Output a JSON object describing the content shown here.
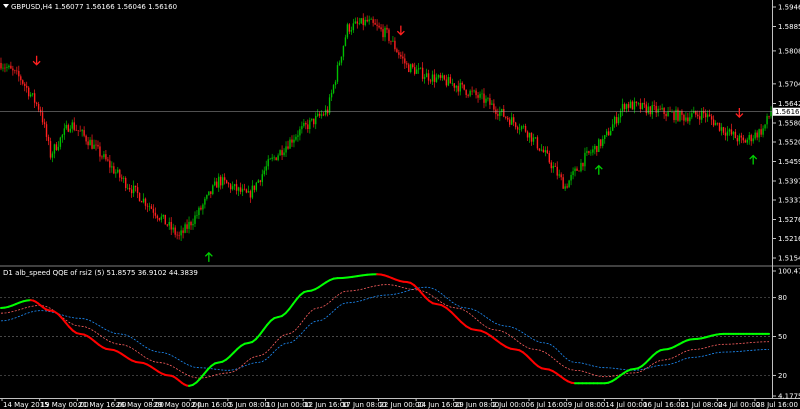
{
  "window": {
    "main_title": "GBPUSD,H4  1.56077 1.56166 1.56046 1.56160",
    "indicator_title": "D1 alb_speed QQE of rsi2 (5) 51.8575 36.9102 44.3839",
    "title_icon": "triangle-down-icon"
  },
  "colors": {
    "background": "#000000",
    "bull_candle": "#00c000",
    "bear_candle": "#ff2020",
    "axis": "#c0c0c0",
    "grid": "#404040",
    "current_price_line": "#a0a0a0",
    "current_price_label_bg": "#ffffff",
    "up_arrow": "#00d000",
    "down_arrow": "#ff2020",
    "qqe_up": "#00ff00",
    "qqe_down": "#ff0000",
    "qqe_fast": "#ff6060",
    "qqe_slow": "#1e90ff"
  },
  "price_axis": {
    "ticks": [
      "1.59465",
      "1.58850",
      "1.58080",
      "1.57040",
      "1.56420",
      "1.55805",
      "1.55205",
      "1.54590",
      "1.53975",
      "1.53375",
      "1.52760",
      "1.52160",
      "1.51545"
    ],
    "current_price": "1.56160"
  },
  "indicator_axis": {
    "ticks": [
      "100.4785",
      "80",
      "50",
      "20",
      "4.1775"
    ]
  },
  "time_axis": {
    "labels": [
      "14 May 2015",
      "19 May 00:00",
      "21 May 16:00",
      "26 May 08:00",
      "29 May 00:00",
      "2 Jun 16:00",
      "5 Jun 08:00",
      "10 Jun 00:00",
      "12 Jun 16:00",
      "17 Jun 08:00",
      "22 Jun 00:00",
      "24 Jun 16:00",
      "29 Jun 08:00",
      "2 Jul 00:00",
      "6 Jul 16:00",
      "9 Jul 08:00",
      "14 Jul 00:00",
      "16 Jul 16:00",
      "21 Jul 08:00",
      "24 Jul 00:00",
      "28 Jul 16:00"
    ]
  },
  "chart_data": {
    "type": "candlestick",
    "symbol": "GBPUSD",
    "timeframe": "H4",
    "ylim": [
      1.51545,
      1.59465
    ],
    "current_price": 1.5616,
    "anchors": [
      [
        0,
        1.577
      ],
      [
        10,
        1.572
      ],
      [
        20,
        1.562
      ],
      [
        25,
        1.548
      ],
      [
        35,
        1.558
      ],
      [
        45,
        1.552
      ],
      [
        60,
        1.541
      ],
      [
        75,
        1.532
      ],
      [
        90,
        1.522
      ],
      [
        100,
        1.53
      ],
      [
        110,
        1.54
      ],
      [
        125,
        1.535
      ],
      [
        135,
        1.545
      ],
      [
        150,
        1.555
      ],
      [
        165,
        1.562
      ],
      [
        170,
        1.575
      ],
      [
        175,
        1.588
      ],
      [
        185,
        1.59
      ],
      [
        195,
        1.586
      ],
      [
        205,
        1.576
      ],
      [
        215,
        1.573
      ],
      [
        230,
        1.57
      ],
      [
        245,
        1.565
      ],
      [
        255,
        1.56
      ],
      [
        265,
        1.556
      ],
      [
        275,
        1.548
      ],
      [
        285,
        1.538
      ],
      [
        295,
        1.547
      ],
      [
        305,
        1.553
      ],
      [
        315,
        1.564
      ],
      [
        330,
        1.562
      ],
      [
        345,
        1.56
      ],
      [
        355,
        1.561
      ],
      [
        365,
        1.556
      ],
      [
        375,
        1.552
      ],
      [
        385,
        1.556
      ],
      [
        389,
        1.5616
      ]
    ],
    "up_arrows": [
      [
        105,
        1.5155
      ],
      [
        302,
        1.543
      ],
      [
        380,
        1.5462
      ]
    ],
    "down_arrows": [
      [
        18,
        1.578
      ],
      [
        202,
        1.5875
      ],
      [
        373,
        1.5615
      ]
    ],
    "qqe": {
      "ylim": [
        4.1775,
        100.4785
      ],
      "levels": [
        80,
        50,
        20
      ],
      "main": [
        [
          0,
          72
        ],
        [
          15,
          78
        ],
        [
          25,
          70
        ],
        [
          40,
          52
        ],
        [
          55,
          40
        ],
        [
          70,
          30
        ],
        [
          85,
          20
        ],
        [
          95,
          12
        ],
        [
          110,
          30
        ],
        [
          125,
          45
        ],
        [
          140,
          65
        ],
        [
          155,
          85
        ],
        [
          170,
          95
        ],
        [
          190,
          98
        ],
        [
          205,
          92
        ],
        [
          220,
          75
        ],
        [
          240,
          55
        ],
        [
          260,
          40
        ],
        [
          275,
          25
        ],
        [
          290,
          14
        ],
        [
          305,
          14
        ],
        [
          320,
          25
        ],
        [
          335,
          40
        ],
        [
          350,
          48
        ],
        [
          365,
          52
        ],
        [
          375,
          52
        ],
        [
          388,
          52
        ]
      ],
      "fast": [
        [
          0,
          68
        ],
        [
          20,
          74
        ],
        [
          40,
          58
        ],
        [
          60,
          44
        ],
        [
          80,
          30
        ],
        [
          100,
          18
        ],
        [
          115,
          22
        ],
        [
          130,
          35
        ],
        [
          145,
          52
        ],
        [
          160,
          72
        ],
        [
          175,
          85
        ],
        [
          195,
          90
        ],
        [
          210,
          86
        ],
        [
          230,
          72
        ],
        [
          250,
          55
        ],
        [
          270,
          40
        ],
        [
          290,
          24
        ],
        [
          305,
          19
        ],
        [
          320,
          22
        ],
        [
          335,
          32
        ],
        [
          350,
          40
        ],
        [
          365,
          44
        ],
        [
          388,
          46
        ]
      ],
      "slow": [
        [
          0,
          62
        ],
        [
          20,
          70
        ],
        [
          40,
          64
        ],
        [
          60,
          52
        ],
        [
          80,
          38
        ],
        [
          100,
          26
        ],
        [
          115,
          24
        ],
        [
          130,
          30
        ],
        [
          145,
          45
        ],
        [
          160,
          62
        ],
        [
          175,
          76
        ],
        [
          195,
          82
        ],
        [
          215,
          88
        ],
        [
          235,
          72
        ],
        [
          255,
          58
        ],
        [
          275,
          45
        ],
        [
          290,
          30
        ],
        [
          305,
          26
        ],
        [
          320,
          24
        ],
        [
          335,
          28
        ],
        [
          350,
          34
        ],
        [
          365,
          38
        ],
        [
          388,
          40
        ]
      ],
      "last_values": [
        51.8575,
        36.9102,
        44.3839
      ]
    }
  }
}
